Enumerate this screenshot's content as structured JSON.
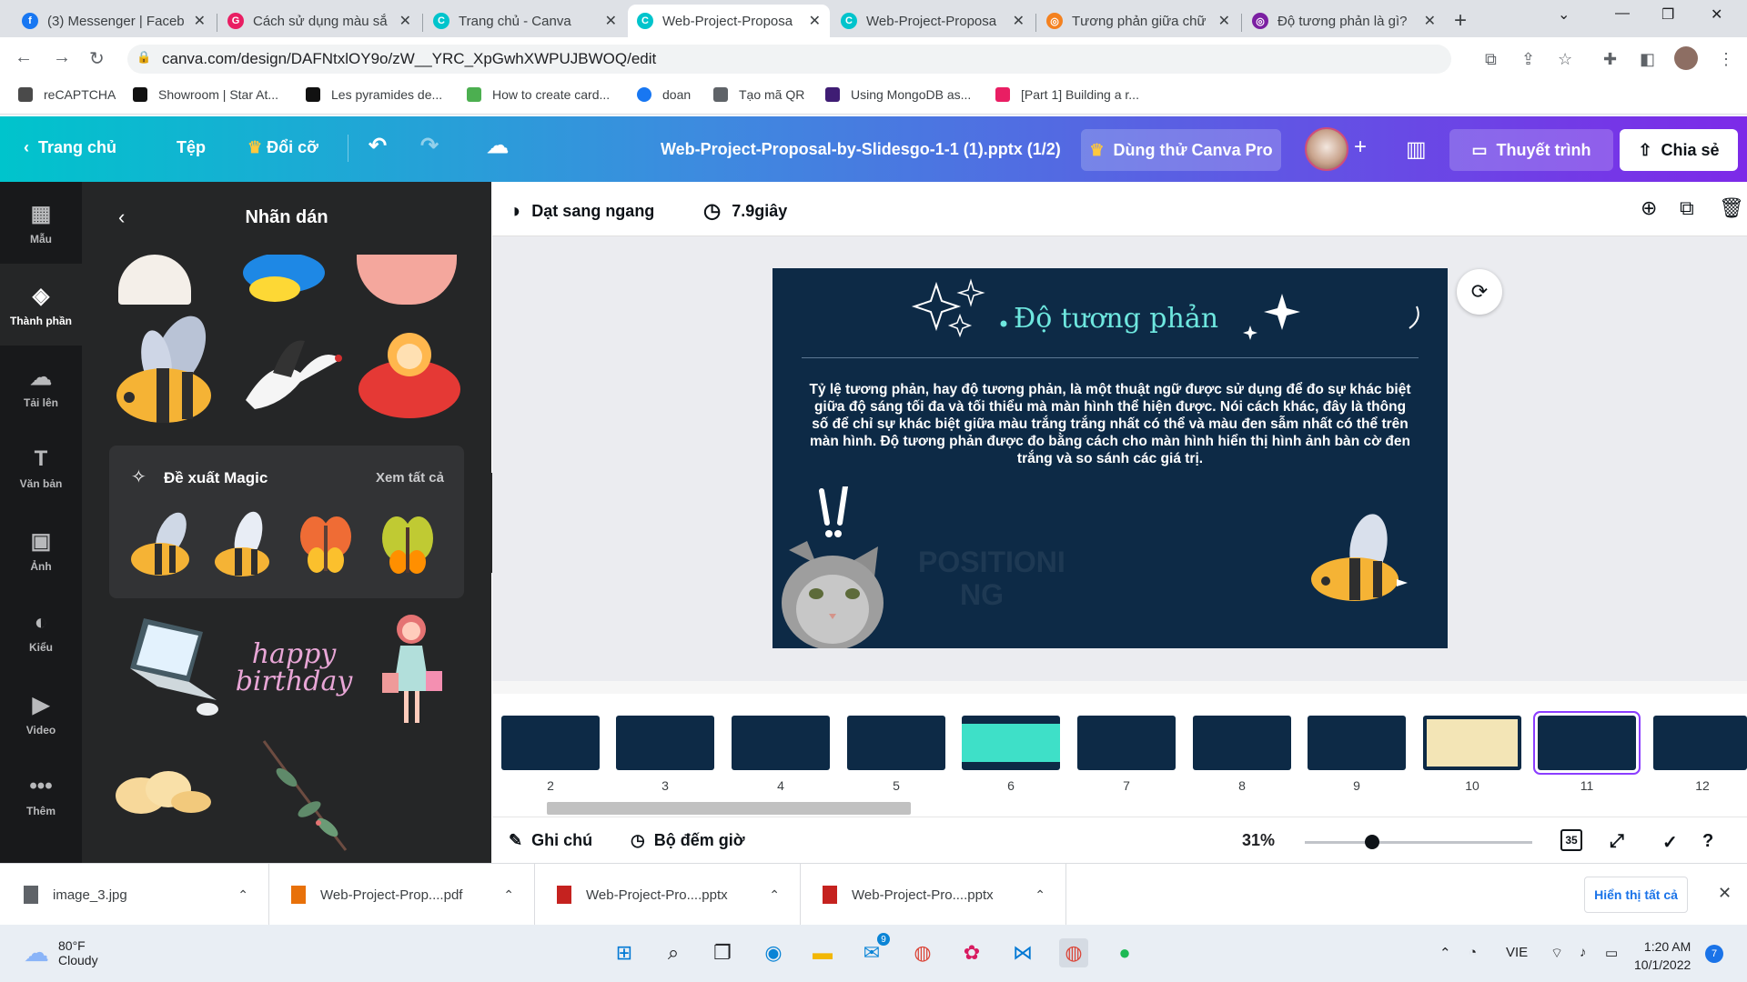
{
  "browser": {
    "tabs": [
      {
        "title": "(3) Messenger | Faceb",
        "icon": "facebook-icon",
        "color": "#1877f2"
      },
      {
        "title": "Cách sử dụng màu sắ",
        "icon": "app-icon",
        "color": "#e91e63"
      },
      {
        "title": "Trang chủ - Canva",
        "icon": "canva-icon",
        "color": "#00c4cc"
      },
      {
        "title": "Web-Project-Proposa",
        "icon": "canva-icon",
        "color": "#00c4cc"
      },
      {
        "title": "Web-Project-Proposa",
        "icon": "canva-icon",
        "color": "#00c4cc"
      },
      {
        "title": "Tương phản giữa chữ",
        "icon": "web-icon",
        "color": "#f4811f"
      },
      {
        "title": "Độ tương phản là gì?",
        "icon": "web-icon",
        "color": "#7b1fa2"
      }
    ],
    "url": "canva.com/design/DAFNtxlOY9o/zW__YRC_XpGwhXWPUJBWOQ/edit",
    "bookmarks": [
      {
        "label": "reCAPTCHA",
        "color": "#4a4a4a"
      },
      {
        "label": "Showroom | Star At...",
        "color": "#111111"
      },
      {
        "label": "Les pyramides de...",
        "color": "#111111"
      },
      {
        "label": "How to create card...",
        "color": "#4caf50"
      },
      {
        "label": "doan",
        "color": "#1877f2"
      },
      {
        "label": "Tạo mã QR",
        "color": "#5f6368"
      },
      {
        "label": "Using MongoDB as...",
        "color": "#3f1d74"
      },
      {
        "label": "[Part 1] Building a r...",
        "color": "#e91e63"
      }
    ]
  },
  "canva": {
    "home": "Trang chủ",
    "file": "Tệp",
    "resize": "Đổi cỡ",
    "doc_title": "Web-Project-Proposal-by-Slidesgo-1-1 (1).pptx (1/2)",
    "pro": "Dùng thử Canva Pro",
    "present": "Thuyết trình",
    "share": "Chia sẻ",
    "sidenav": [
      {
        "label": "Mẫu",
        "icon": "template-icon",
        "glyph": "▦"
      },
      {
        "label": "Thành phần",
        "icon": "elements-icon",
        "glyph": "◈"
      },
      {
        "label": "Tải lên",
        "icon": "upload-icon",
        "glyph": "☁"
      },
      {
        "label": "Văn bản",
        "icon": "text-icon",
        "glyph": "T"
      },
      {
        "label": "Ảnh",
        "icon": "photo-icon",
        "glyph": "▣"
      },
      {
        "label": "Kiểu",
        "icon": "style-icon",
        "glyph": "◐"
      },
      {
        "label": "Video",
        "icon": "video-icon",
        "glyph": "▶"
      },
      {
        "label": "Thêm",
        "icon": "more-icon",
        "glyph": "•••"
      }
    ],
    "panel_title": "Nhãn dán",
    "magic_title": "Đề xuất Magic",
    "magic_all": "Xem tất cả",
    "sticker_text": "happy birthday",
    "transition": "Dạt sang ngang",
    "duration": "7.9giây",
    "slide": {
      "title": "Độ tương phản",
      "body": "Tỷ lệ tương phản, hay độ tương phản, là một thuật ngữ được sử dụng để đo sự khác biệt giữa độ sáng tối đa và tối thiểu mà màn hình thể hiện được. Nói cách khác, đây là thông số để chỉ sự khác biệt giữa màu trắng trắng nhất có thể và màu đen sẫm nhất có thể trên màn hình. Độ tương phản được đo bằng cách cho màn hình hiển thị hình ảnh bàn cờ đen trắng  và so sánh các giá trị.",
      "ghost_text": "POSITIONI NG"
    },
    "thumbnails": [
      "2",
      "3",
      "4",
      "5",
      "6",
      "7",
      "8",
      "9",
      "10",
      "11",
      "12"
    ],
    "notes": "Ghi chú",
    "timer": "Bộ đếm giờ",
    "zoom": "31%",
    "zoom_fraction": 0.31,
    "page_count": "35"
  },
  "downloads": [
    {
      "name": "image_3.jpg",
      "color": "#5f6368"
    },
    {
      "name": "Web-Project-Prop....pdf",
      "color": "#e8710a"
    },
    {
      "name": "Web-Project-Pro....pptx",
      "color": "#c5221f"
    },
    {
      "name": "Web-Project-Pro....pptx",
      "color": "#c5221f"
    }
  ],
  "show_all": "Hiển thị tất cả",
  "taskbar": {
    "temp": "80°F",
    "weather": "Cloudy",
    "lang": "VIE",
    "time": "1:20 AM",
    "date": "10/1/2022",
    "notifications": "7",
    "mail_badge": "9"
  }
}
